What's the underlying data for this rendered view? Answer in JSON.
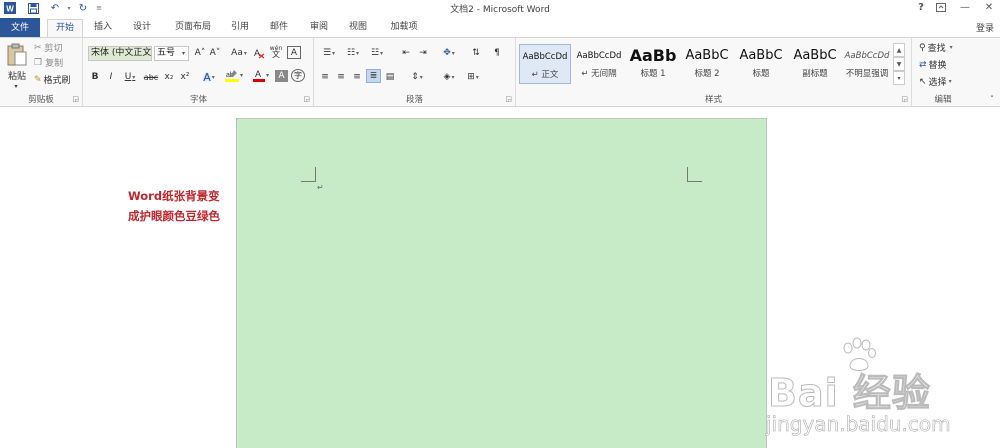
{
  "titlebar": {
    "title": "文档2 - Microsoft Word",
    "help": "?",
    "minimize": "—",
    "close": "✕"
  },
  "tabs": [
    "文件",
    "开始",
    "插入",
    "设计",
    "页面布局",
    "引用",
    "邮件",
    "审阅",
    "视图",
    "加载项"
  ],
  "login_label": "登录",
  "clipboard": {
    "paste": "粘贴",
    "cut": "剪切",
    "copy": "复制",
    "format_painter": "格式刷",
    "group_label": "剪贴板"
  },
  "font": {
    "family": "宋体 (中文正文",
    "size": "五号",
    "group_label": "字体",
    "bold": "B",
    "italic": "I",
    "underline": "U",
    "strike": "abc",
    "subscript": "x₂",
    "superscript": "x²",
    "grow": "A˄",
    "shrink": "A˅",
    "case": "Aa",
    "phonetic": "wén",
    "border": "A",
    "shading": "A",
    "enclose": "字"
  },
  "paragraph": {
    "group_label": "段落"
  },
  "styles": {
    "group_label": "样式",
    "items": [
      {
        "sample": "AaBbCcDd",
        "name": "↵ 正文"
      },
      {
        "sample": "AaBbCcDd",
        "name": "↵ 无间隔"
      },
      {
        "sample": "AaBb",
        "name": "标题 1"
      },
      {
        "sample": "AaBbC",
        "name": "标题 2"
      },
      {
        "sample": "AaBbC",
        "name": "标题"
      },
      {
        "sample": "AaBbC",
        "name": "副标题"
      },
      {
        "sample": "AaBbCcDd",
        "name": "不明显强调"
      }
    ]
  },
  "editing": {
    "find": "查找",
    "replace": "替换",
    "select": "选择",
    "group_label": "编辑"
  },
  "document": {
    "paragraph_mark": "↵",
    "page_color": "#c7ebc7"
  },
  "annotation": {
    "line1": "Word纸张背景变",
    "line2": "成护眼颜色豆绿色"
  },
  "watermark": {
    "brand": "Bai 经验",
    "url": "jingyan.baidu.com"
  }
}
